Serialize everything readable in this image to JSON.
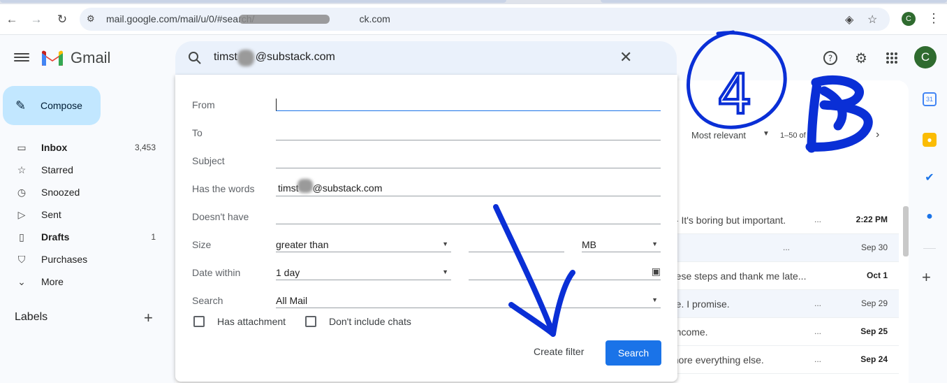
{
  "browser": {
    "url": "mail.google.com/mail/u/0/#search/",
    "url_tail": "ck.com",
    "profile_initial": "C"
  },
  "header": {
    "app_name": "Gmail",
    "search_query_prefix": "timst",
    "search_query_suffix": "@substack.com",
    "avatar_initial": "C"
  },
  "nav": {
    "compose_label": "Compose",
    "items": [
      {
        "label": "Inbox",
        "count": "3,453",
        "icon": "inbox-icon",
        "bold": true
      },
      {
        "label": "Starred",
        "count": "",
        "icon": "star-icon",
        "bold": false
      },
      {
        "label": "Snoozed",
        "count": "",
        "icon": "clock-icon",
        "bold": false
      },
      {
        "label": "Sent",
        "count": "",
        "icon": "send-icon",
        "bold": false
      },
      {
        "label": "Drafts",
        "count": "1",
        "icon": "draft-icon",
        "bold": true
      },
      {
        "label": "Purchases",
        "count": "",
        "icon": "bag-icon",
        "bold": false
      },
      {
        "label": "More",
        "count": "",
        "icon": "chevron-down-icon",
        "bold": false
      }
    ],
    "labels_heading": "Labels"
  },
  "toolbar": {
    "sort_label": "Most relevant",
    "page_count": "1–50 of m"
  },
  "messages": [
    {
      "snippet": "s - It's boring but important.",
      "dots": "...",
      "date": "2:22 PM",
      "unread": true
    },
    {
      "snippet": "",
      "dots": "...",
      "date": "Sep 30",
      "unread": false
    },
    {
      "snippet": "these steps and thank me late...",
      "dots": "",
      "date": "Oct 1",
      "unread": true
    },
    {
      "snippet": "me. I promise.",
      "dots": "...",
      "date": "Sep 29",
      "unread": false
    },
    {
      "snippet": "r income.",
      "dots": "...",
      "date": "Sep 25",
      "unread": true
    },
    {
      "snippet": "gnore everything else.",
      "dots": "...",
      "date": "Sep 24",
      "unread": true
    }
  ],
  "advanced": {
    "from_label": "From",
    "to_label": "To",
    "subject_label": "Subject",
    "has_words_label": "Has the words",
    "has_words_prefix": "timst",
    "has_words_suffix": "@substack.com",
    "doesnt_have_label": "Doesn't have",
    "size_label": "Size",
    "size_op": "greater than",
    "size_unit": "MB",
    "date_label": "Date within",
    "date_value": "1 day",
    "search_label": "Search",
    "search_scope": "All Mail",
    "has_attachment": "Has attachment",
    "dont_include_chats": "Don't include chats",
    "create_filter": "Create filter",
    "search_button": "Search"
  },
  "annotations": {
    "circled_number": "4",
    "scribble_letter": "B",
    "ink_color": "#0a2fd6"
  }
}
